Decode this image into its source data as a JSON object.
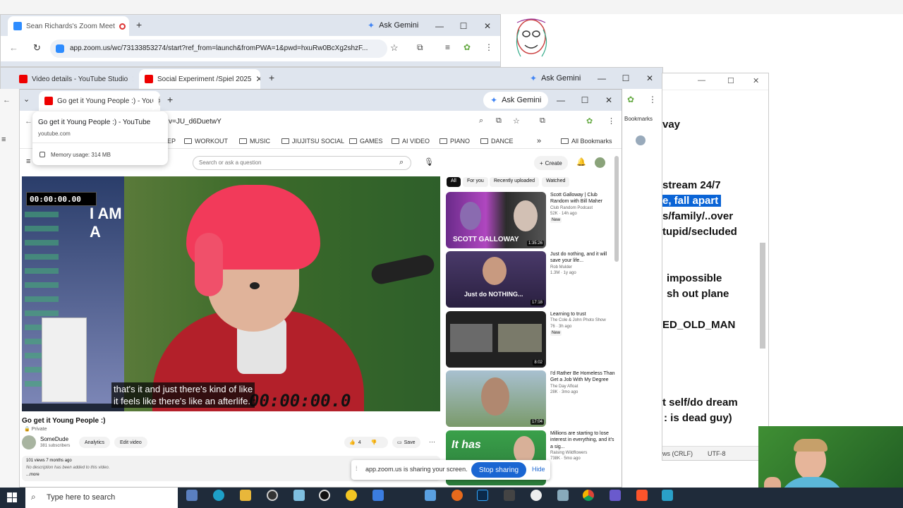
{
  "zoom_window": {
    "tab_title": "Sean Richards's Zoom Meet",
    "url": "app.zoom.us/wc/73133853274/start?ref_from=launch&fromPWA=1&pwd=hxuRw0BcXg2shzF...",
    "gemini": "Ask Gemini"
  },
  "mid_window": {
    "tab1": "Video details - YouTube Studio",
    "tab2": "Social Experiment /Spiel 2025",
    "gemini": "Ask Gemini"
  },
  "front_window": {
    "tab": "Go get it Young People :) - You",
    "gemini": "Ask Gemini",
    "address_partial": "v=JU_d6DuetwY",
    "hover_card": {
      "title": "Go get it Young People :) - YouTube",
      "domain": "youtube.com",
      "memory": "Memory usage: 314 MB"
    },
    "bookmarks": [
      "EP",
      "WORKOUT",
      "MUSIC",
      "JIUJITSU SOCIAL",
      "GAMES",
      "AI VIDEO",
      "PIANO",
      "DANCE"
    ],
    "all_bookmarks": "All Bookmarks",
    "search_placeholder": "Search or ask a question",
    "create_label": "Create"
  },
  "video": {
    "timer_overlay": "00:00:00.00",
    "left_text": "I AM A",
    "big_timer": "00:00:00.0",
    "caption_line1": "that's it and just there's kind of like",
    "caption_line2": "it feels like there's like an afterlife.",
    "title": "Go get it Young People :)",
    "privacy": "Private",
    "channel": "SomeDude",
    "subscribers": "381 subscribers",
    "analytics": "Analytics",
    "edit_video": "Edit video",
    "likes": "4",
    "save": "Save",
    "views": "101 views  7 months ago",
    "description": "No description has been added to this video.",
    "more": "...more"
  },
  "chips": [
    "All",
    "For you",
    "Recently uploaded",
    "Watched"
  ],
  "recommendations": [
    {
      "title": "Scott Galloway | Club Random with Bill Maher",
      "channel": "Club Random Podcast",
      "meta": "52K · 14h ago",
      "badge": "New",
      "duration": "1:35:26",
      "thumb_text": "SCOTT GALLOWAY"
    },
    {
      "title": "Just do nothing, and it will save your life...",
      "channel": "Rob Mulder",
      "meta": "1.3M · 1y ago",
      "badge": "",
      "duration": "17:18",
      "thumb_text": "Just do NOTHING..."
    },
    {
      "title": "Learning to trust",
      "channel": "The Cole & John Photo Show",
      "meta": "76 · 3h ago",
      "badge": "New",
      "duration": "8:02",
      "thumb_text": ""
    },
    {
      "title": "I'd Rather Be Homeless Than Get a Job With My Degree",
      "channel": "The Day Afloat",
      "meta": "28K · 3mo ago",
      "badge": "",
      "duration": "17:04",
      "thumb_text": ""
    },
    {
      "title": "Millions are starting to lose interest in everything, and it's a sig...",
      "channel": "Raising Wildflowers",
      "meta": "738K · 5mo ago",
      "badge": "",
      "duration": "",
      "thumb_text": "It has"
    }
  ],
  "share_bar": {
    "text": "app.zoom.us is sharing your screen.",
    "stop": "Stop sharing",
    "hide": "Hide"
  },
  "notepad": {
    "lines": [
      "vay",
      "stream 24/7",
      "e, fall apart",
      "s/family/..over",
      "tupid/secluded",
      "impossible",
      "sh out plane",
      "ED_OLD_MAN",
      "t self/do dream",
      ": is dead guy)"
    ],
    "status_crlf": "ws (CRLF)",
    "status_enc": "UTF-8"
  },
  "right_browser": {
    "bookmarks": "Bookmarks"
  },
  "taskbar": {
    "search": "Type here to search"
  }
}
